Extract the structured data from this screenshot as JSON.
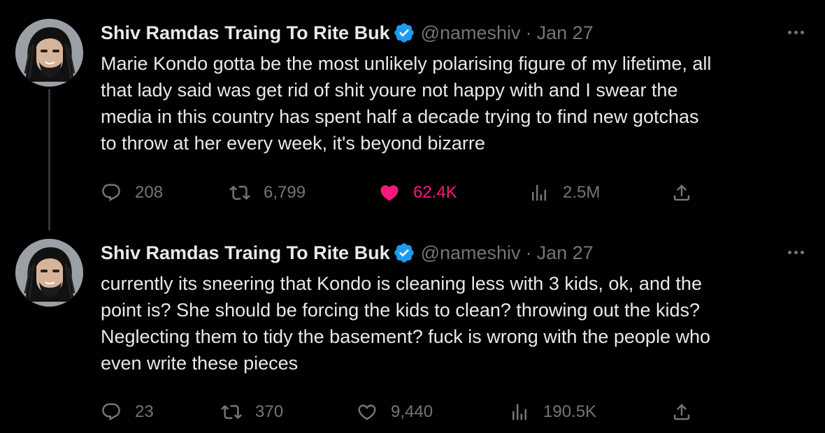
{
  "tweets": [
    {
      "author_name": "Shiv Ramdas Traing To Rite Buk",
      "handle": "@nameshiv",
      "separator": "·",
      "date": "Jan 27",
      "text_lines": [
        "Marie Kondo gotta be the most unlikely polarising figure of my lifetime, all",
        "that lady said was get rid of shit youre not happy with and I swear the",
        "media in this country has spent half a decade trying to find new gotchas",
        "to throw at her every week, it's beyond bizarre"
      ],
      "stats": {
        "replies": "208",
        "retweets": "6,799",
        "likes": "62.4K",
        "views": "2.5M"
      },
      "liked": true
    },
    {
      "author_name": "Shiv Ramdas Traing To Rite Buk",
      "handle": "@nameshiv",
      "separator": "·",
      "date": "Jan 27",
      "text_lines": [
        "currently its sneering that Kondo is cleaning less with 3 kids, ok, and the",
        "point is? She should be forcing the kids to clean? throwing out the kids?",
        "Neglecting them to tidy the basement? fuck is wrong with the people who",
        "even write these pieces"
      ],
      "stats": {
        "replies": "23",
        "retweets": "370",
        "likes": "9,440",
        "views": "190.5K"
      },
      "liked": false
    }
  ],
  "icons": {
    "verified": "verified-badge-icon",
    "more": "more-options-icon",
    "reply": "reply-icon",
    "retweet": "retweet-icon",
    "like": "heart-icon",
    "views": "views-chart-icon",
    "share": "share-icon"
  },
  "colors": {
    "background": "#000000",
    "text": "#e7e9ea",
    "muted": "#71767b",
    "verified": "#1d9bf0",
    "like_active": "#f91880",
    "thread_line": "#333639"
  }
}
